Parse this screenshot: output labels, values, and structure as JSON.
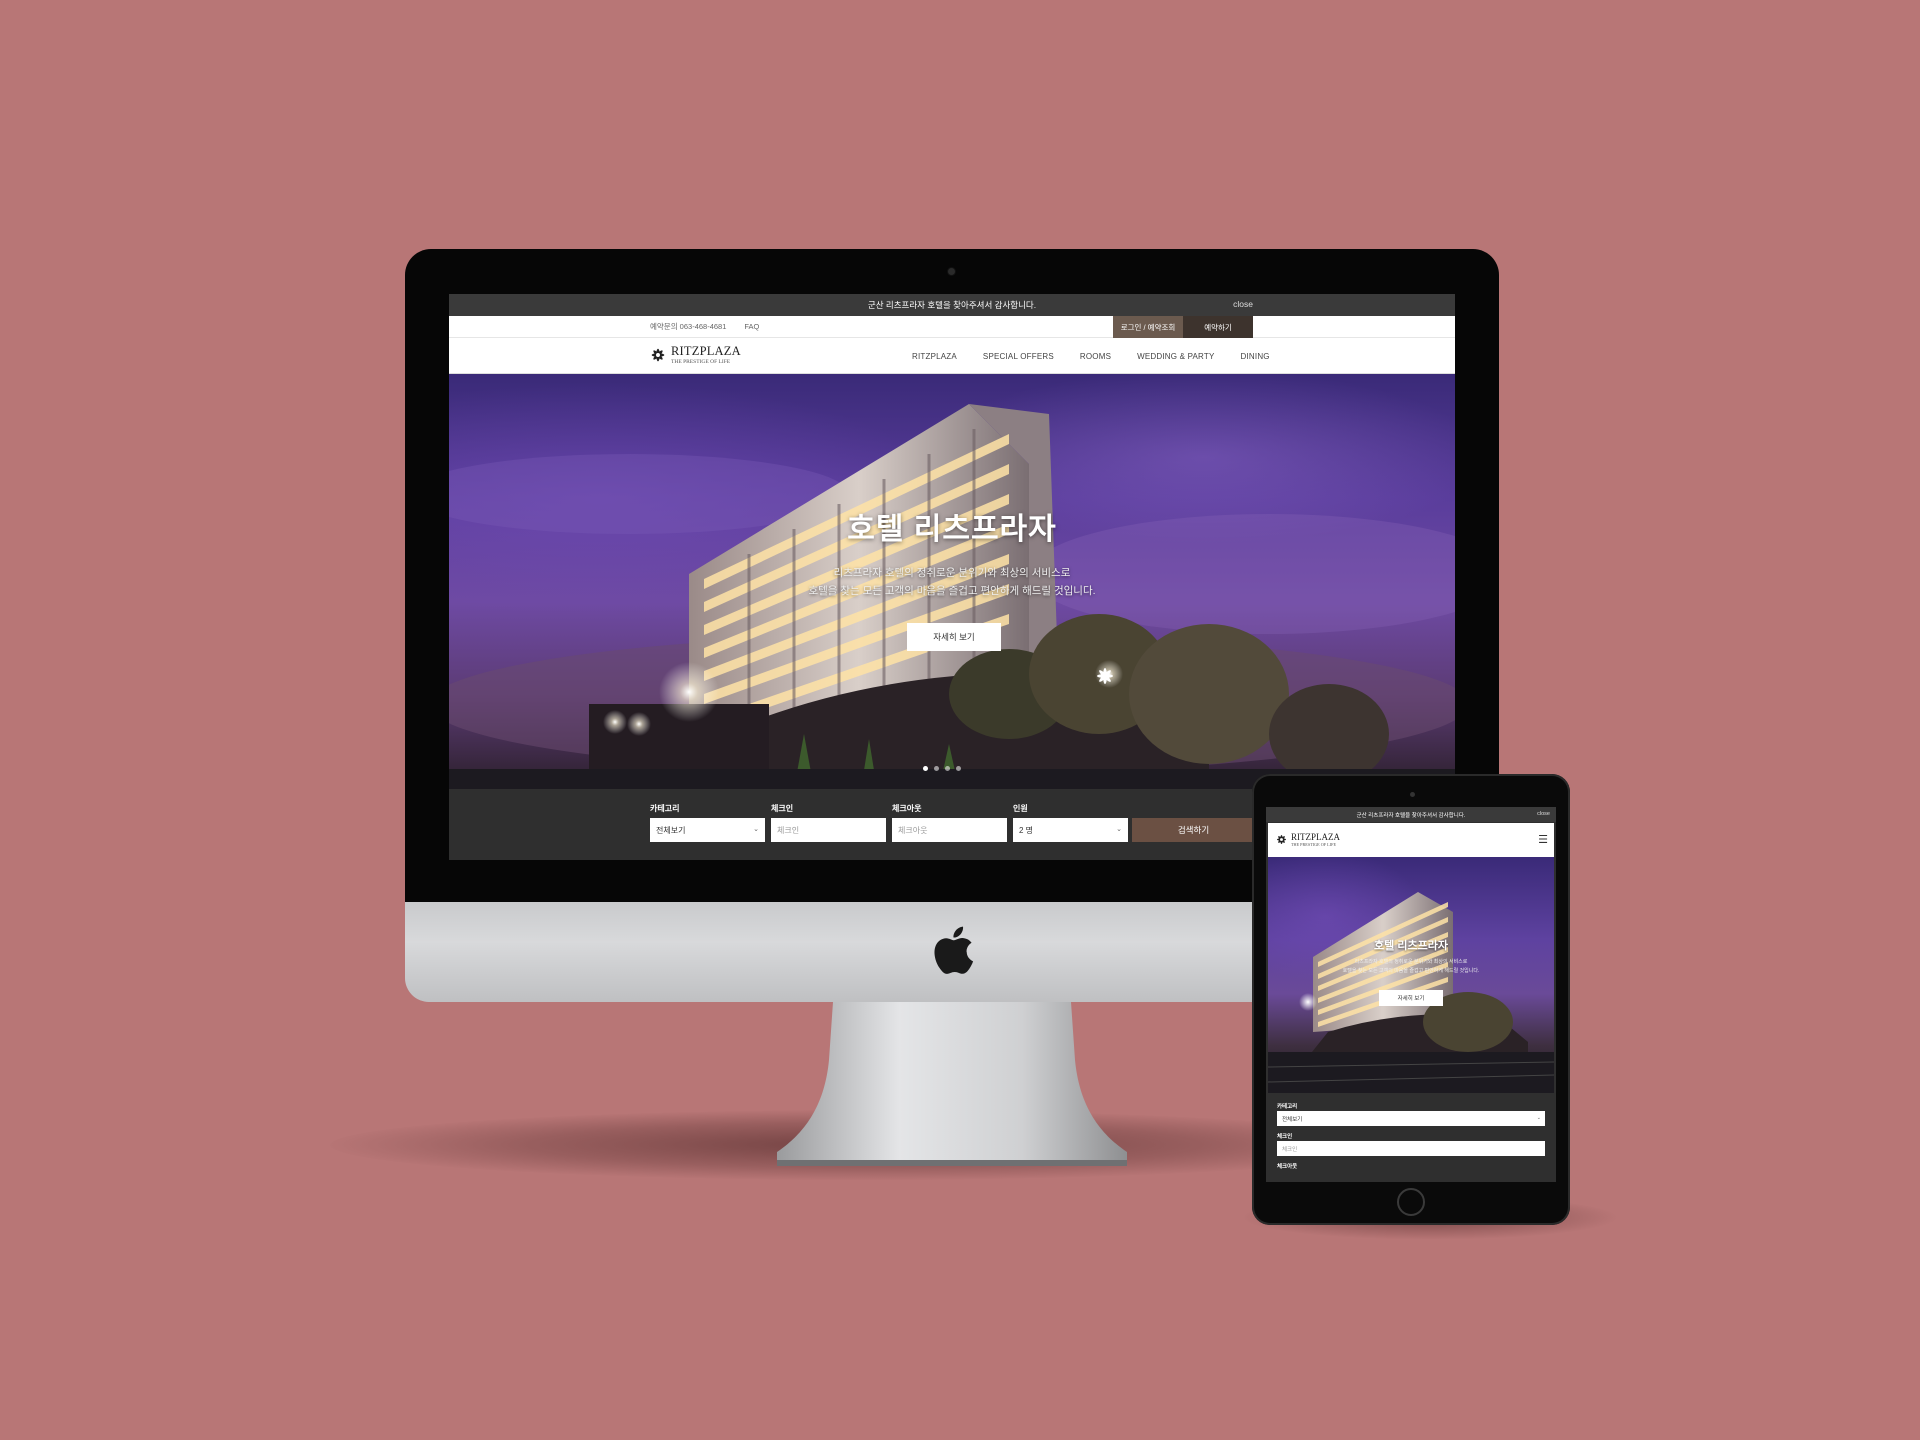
{
  "desktop": {
    "notice_bar": {
      "message": "군산 리츠프라자 호텔을 찾아주셔서 감사합니다.",
      "close_label": "close"
    },
    "utility": {
      "phone": "예약문의 063-468-4681",
      "faq": "FAQ",
      "login_label": "로그인 / 예약조회",
      "reserve_label": "예약하기"
    },
    "logo": {
      "name": "RITZPLAZA",
      "tagline": "THE PRESTIGE OF LIFE"
    },
    "menu": [
      "RITZPLAZA",
      "SPECIAL OFFERS",
      "ROOMS",
      "WEDDING & PARTY",
      "DINING"
    ],
    "hero": {
      "title": "호텔 리츠프라자",
      "line1": "리츠프라자 호텔의 정취로운 분위기와 최상의 서비스로",
      "line2": "호텔을 찾는 모든 고객의 마음을 즐겁고 편안하게 해드릴 것입니다.",
      "button_label": "자세히 보기",
      "slide_count": 4,
      "active_slide": 1
    },
    "search": {
      "category_label": "카테고리",
      "category_value": "전체보기",
      "checkin_label": "체크인",
      "checkin_placeholder": "체크인",
      "checkout_label": "체크아웃",
      "checkout_placeholder": "체크아웃",
      "guests_label": "인원",
      "guests_value": "2 명",
      "submit_label": "검색하기"
    }
  },
  "tablet": {
    "notice_message": "군산 리츠프라자 호텔을 찾아주셔서 감사합니다.",
    "close_label": "close",
    "logo_name": "RITZPLAZA",
    "logo_tagline": "THE PRESTIGE OF LIFE",
    "menu_icon": "hamburger-icon",
    "hero_title": "호텔 리츠프라자",
    "hero_line1": "리츠프라자 호텔의 정취로운 분위기와 최상의 서비스로",
    "hero_line2": "호텔을 찾는 모든 고객의 마음을 즐겁고 편안하게 해드릴 것입니다.",
    "hero_button": "자세히 보기",
    "category_label": "카테고리",
    "category_value": "전체보기",
    "checkin_label": "체크인",
    "checkin_placeholder": "체크인",
    "checkout_label": "체크아웃"
  },
  "colors": {
    "background": "#b87676",
    "accent_brown": "#6b5043",
    "login_brown": "#6b5a4e",
    "dark_panel": "#2f2f2f"
  }
}
